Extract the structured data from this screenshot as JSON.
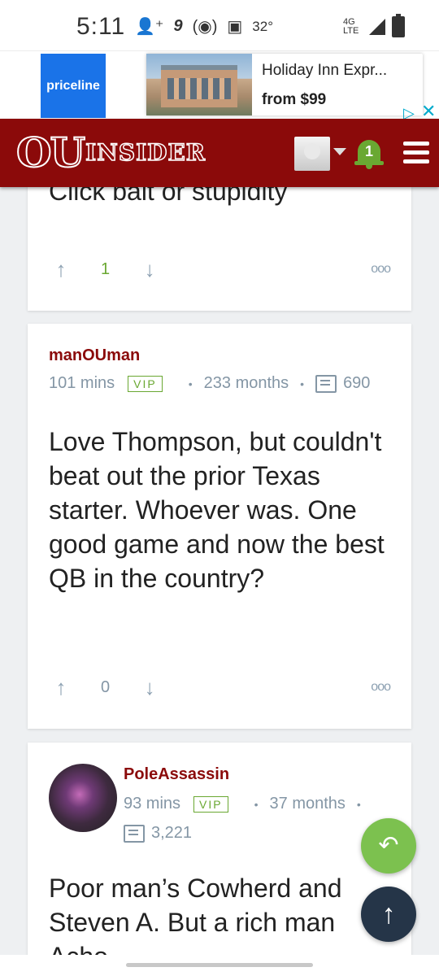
{
  "status_bar": {
    "time": "5:11",
    "temperature": "32°",
    "network": "4G LTE"
  },
  "ad": {
    "brand": "priceline",
    "title": "Holiday Inn Expr...",
    "price": "from $99"
  },
  "header": {
    "logo_ou": "OU",
    "logo_text": "INSIDER",
    "notification_count": "1"
  },
  "comments": [
    {
      "text": "Click bait or stupidity",
      "votes": "1",
      "vote_color": "#6aa832"
    },
    {
      "username": "manOUman",
      "time": "101 mins",
      "badge": "VIP",
      "tenure": "233 months",
      "posts": "690",
      "text": "Love Thompson, but couldn't beat out the prior Texas starter. Whoever was. One good game and now the best QB in the country?",
      "votes": "0",
      "vote_color": "#8496a5"
    },
    {
      "username": "PoleAssassin",
      "time": "93 mins",
      "badge": "VIP",
      "tenure": "37 months",
      "posts": "3,221",
      "text": "Poor man’s Cowherd and Steven A. But a rich man Acho..."
    }
  ],
  "fab": {
    "reply_icon": "reply-icon",
    "top_icon": "arrow-up-icon"
  }
}
